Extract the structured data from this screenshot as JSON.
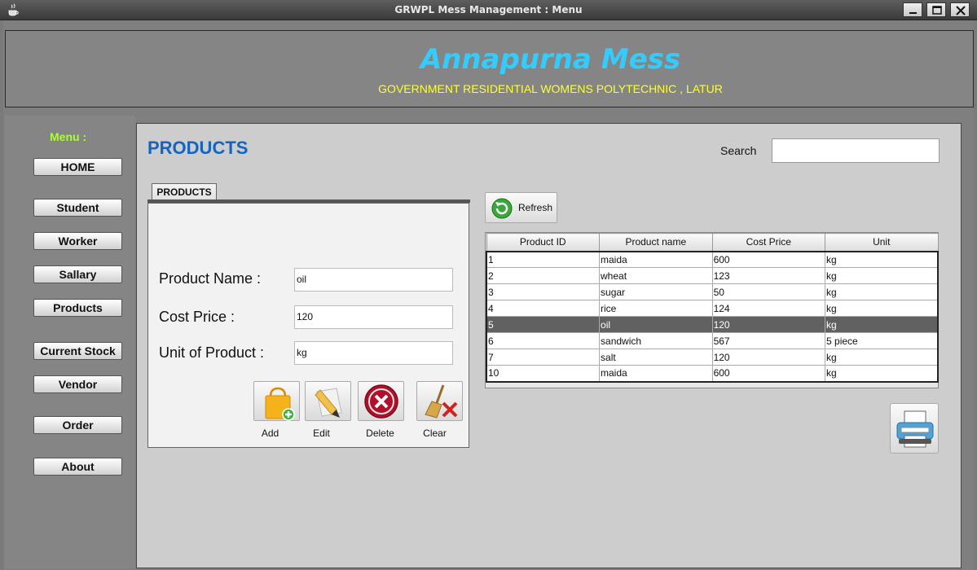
{
  "window": {
    "title": "GRWPL Mess Management  : Menu"
  },
  "header": {
    "brand": "Annapurna Mess",
    "subtitle": "GOVERNMENT RESIDENTIAL WOMENS POLYTECHNIC , LATUR"
  },
  "sidebar": {
    "menu_label": "Menu :",
    "items": [
      {
        "label": "HOME"
      },
      {
        "label": "Student"
      },
      {
        "label": "Worker"
      },
      {
        "label": "Sallary"
      },
      {
        "label": "Products"
      },
      {
        "label": "Current Stock"
      },
      {
        "label": "Vendor"
      },
      {
        "label": "Order"
      },
      {
        "label": "About"
      }
    ]
  },
  "main": {
    "page_title": "PRODUCTS",
    "search": {
      "label": "Search",
      "value": ""
    },
    "tab_label": "PRODUCTS",
    "form": {
      "product_name_label": "Product Name :",
      "product_name_value": "oil",
      "cost_price_label": "Cost Price :",
      "cost_price_value": "120",
      "unit_label": "Unit of Product :",
      "unit_value": "kg"
    },
    "actions": {
      "add": "Add",
      "edit": "Edit",
      "delete": "Delete",
      "clear": "Clear"
    },
    "refresh_label": "Refresh",
    "table": {
      "columns": [
        "Product ID",
        "Product name",
        "Cost Price",
        "Unit"
      ],
      "rows": [
        [
          "1",
          "maida",
          "600",
          "kg"
        ],
        [
          "2",
          "wheat",
          "123",
          "kg"
        ],
        [
          "3",
          "sugar",
          "50",
          "kg"
        ],
        [
          "4",
          "rice",
          "124",
          "kg"
        ],
        [
          "5",
          "oil",
          "120",
          "kg"
        ],
        [
          "6",
          "sandwich",
          "567",
          "5 piece"
        ],
        [
          "7",
          "salt",
          "120",
          "kg"
        ],
        [
          "10",
          "maida",
          "600",
          "kg"
        ]
      ],
      "selected_row": 4
    }
  },
  "colors": {
    "brand": "#33ccff",
    "subtitle": "#ffff33",
    "menu_label": "#aaff33",
    "page_title": "#1565c0",
    "selected_row": "#616161"
  }
}
